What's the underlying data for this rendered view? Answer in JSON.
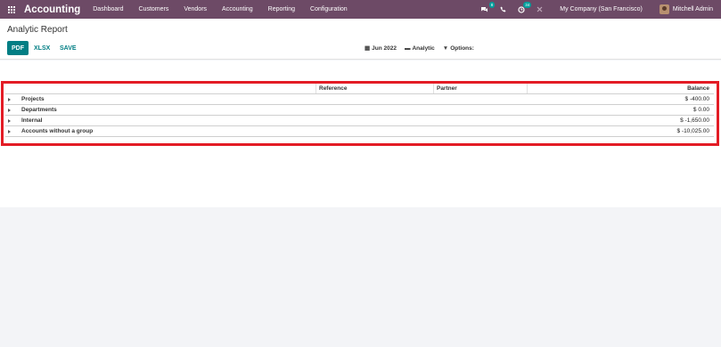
{
  "navbar": {
    "brand": "Accounting",
    "menu": [
      "Dashboard",
      "Customers",
      "Vendors",
      "Accounting",
      "Reporting",
      "Configuration"
    ],
    "messages_badge": "8",
    "activity_badge": "34",
    "company": "My Company (San Francisco)",
    "user": "Mitchell Admin",
    "brand_color": "#6d4a66"
  },
  "control_panel": {
    "title": "Analytic Report",
    "buttons": {
      "pdf": "PDF",
      "xlsx": "XLSX",
      "save": "SAVE"
    },
    "filters": {
      "date": "Jun 2022",
      "analytic": "Analytic",
      "options": "Options:"
    }
  },
  "report": {
    "columns": {
      "reference": "Reference",
      "partner": "Partner",
      "balance": "Balance"
    },
    "rows": [
      {
        "label": "Projects",
        "balance": "$ -400.00"
      },
      {
        "label": "Departments",
        "balance": "$ 0.00"
      },
      {
        "label": "Internal",
        "balance": "$ -1,650.00"
      },
      {
        "label": "Accounts without a group",
        "balance": "$ -10,025.00"
      }
    ],
    "highlight_color": "#e31c25"
  }
}
